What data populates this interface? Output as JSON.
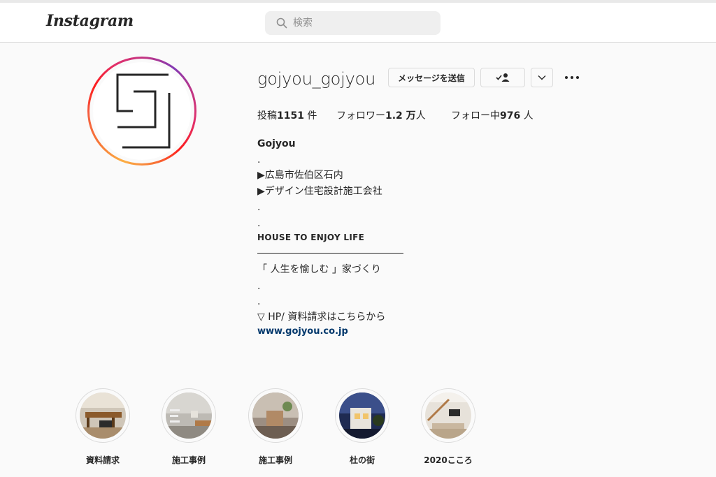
{
  "header": {
    "logo": "Instagram",
    "search": {
      "placeholder": "検索",
      "value": ""
    }
  },
  "profile": {
    "username": "gojyou_gojyou",
    "buttons": {
      "message": "メッセージを送信",
      "following_icon": "person-check-icon",
      "dropdown_icon": "chevron-down-icon",
      "more_icon": "ellipsis-icon"
    },
    "stats": {
      "posts_label": "投稿",
      "posts_value": "1151",
      "posts_unit": " 件",
      "followers_label": "フォロワー",
      "followers_value": "1.2 万",
      "followers_unit": "人",
      "following_label": "フォロー中",
      "following_value": "976",
      "following_unit": " 人"
    },
    "bio": {
      "name": "Gojyou",
      "dot": ".",
      "line1": "▶広島市佐伯区石内",
      "line2": "▶デザイン住宅設計施工会社",
      "tagline": "HOUSE TO ENJOY LIFE",
      "catch": "「 人生を愉しむ 」家づくり",
      "hp": "▽ HP/ 資料請求はこちらから",
      "link": "www.gojyou.co.jp"
    }
  },
  "highlights": [
    {
      "label": "資料請求"
    },
    {
      "label": "施工事例"
    },
    {
      "label": "施工事例"
    },
    {
      "label": "杜の街"
    },
    {
      "label": "2020こころ"
    }
  ],
  "colors": {
    "link": "#00376b",
    "border": "#dbdbdb",
    "background": "#fafafa",
    "text": "#262626"
  }
}
